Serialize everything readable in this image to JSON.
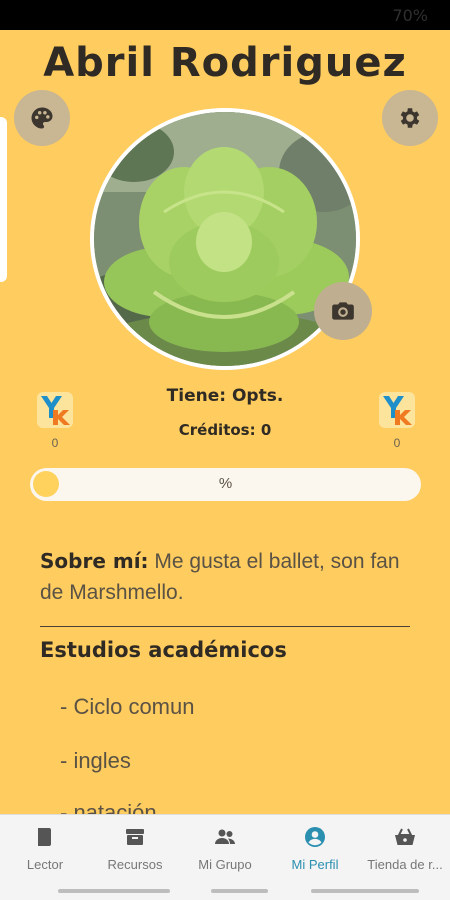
{
  "status_bar": {
    "battery": "70%"
  },
  "profile": {
    "name": "Abril Rodriguez",
    "opts": "Tiene: Opts.",
    "credits": "Créditos: 0",
    "token_left_count": "0",
    "token_right_count": "0",
    "progress_text": "%",
    "progress_value": 0
  },
  "about": {
    "label": "Sobre mí:",
    "text": "Me gusta el ballet, son fan de Marshmello."
  },
  "studies": {
    "title": "Estudios académicos",
    "items": [
      "- Ciclo comun",
      "- ingles",
      "- natación"
    ]
  },
  "nav": {
    "items": [
      {
        "label": "Lector",
        "icon": "book-icon"
      },
      {
        "label": "Recursos",
        "icon": "archive-icon"
      },
      {
        "label": "Mi Grupo",
        "icon": "group-icon"
      },
      {
        "label": "Mi Perfil",
        "icon": "profile-icon",
        "active": true
      },
      {
        "label": "Tienda de r...",
        "icon": "basket-icon"
      }
    ]
  },
  "colors": {
    "background": "#fecc5f",
    "accent": "#2b8fb0"
  }
}
